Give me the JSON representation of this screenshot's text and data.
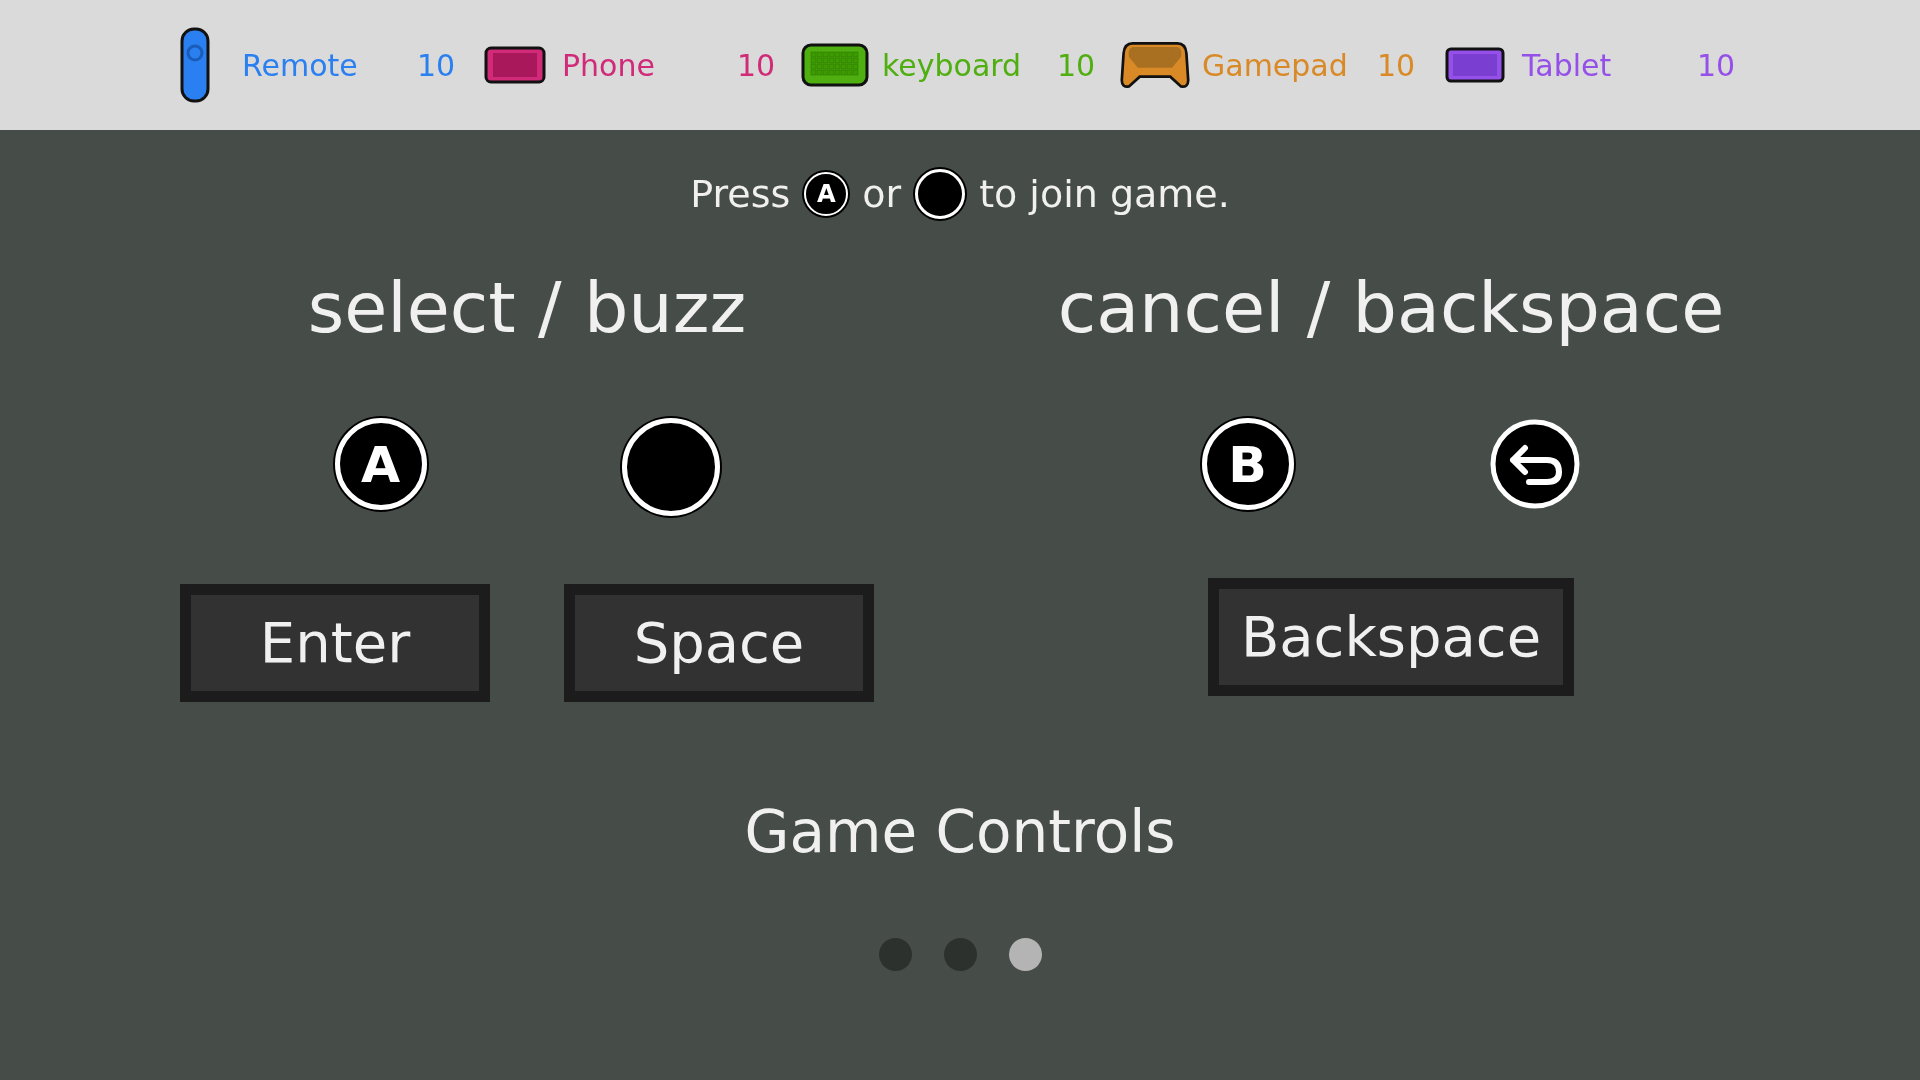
{
  "devices": [
    {
      "kind": "remote",
      "name": "Remote",
      "count": "10",
      "color": "#2a80f0"
    },
    {
      "kind": "phone",
      "name": "Phone",
      "count": "10",
      "color": "#d02a78"
    },
    {
      "kind": "keyboard",
      "name": "keyboard",
      "count": "10",
      "color": "#4fae10"
    },
    {
      "kind": "gamepad",
      "name": "Gamepad",
      "count": "10",
      "color": "#d98a26"
    },
    {
      "kind": "tablet",
      "name": "Tablet",
      "count": "10",
      "color": "#9550ea"
    }
  ],
  "prompt": [
    {
      "kind": "text",
      "text": "Press"
    },
    {
      "kind": "letter",
      "label": "A"
    },
    {
      "kind": "text",
      "text": "or"
    },
    {
      "kind": "circle"
    },
    {
      "kind": "text",
      "text": "to join game."
    }
  ],
  "groups": [
    {
      "title": "select / buzz",
      "glyphs": [
        {
          "kind": "letter",
          "label": "A"
        },
        {
          "kind": "circle"
        }
      ],
      "keys": [
        "Enter",
        "Space"
      ]
    },
    {
      "title": "cancel / backspace",
      "glyphs": [
        {
          "kind": "letter",
          "label": "B"
        },
        {
          "kind": "back"
        }
      ],
      "keys": [
        "Backspace"
      ]
    }
  ],
  "title": "Game Controls",
  "pages": [
    {
      "selected": false
    },
    {
      "selected": false
    },
    {
      "selected": true
    }
  ]
}
